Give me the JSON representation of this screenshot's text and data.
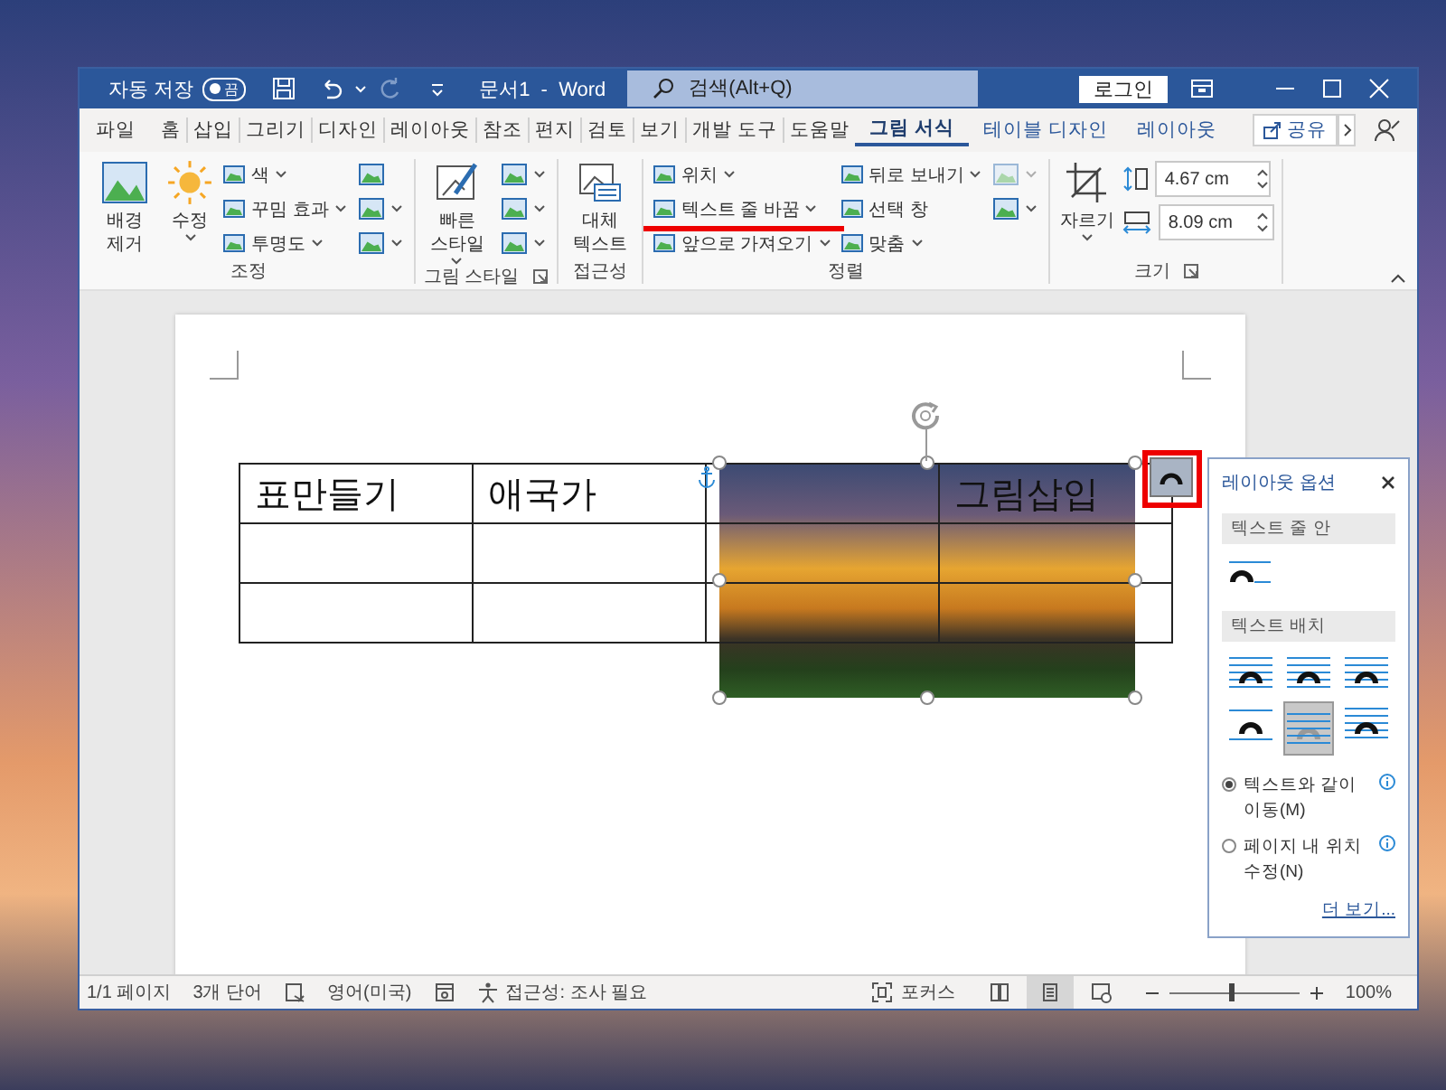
{
  "title_bar": {
    "autosave_label": "자동 저장",
    "autosave_toggle": {
      "label": "끔",
      "on": false
    },
    "document_title": "문서1  -  Word",
    "search": {
      "placeholder": "검색(Alt+Q)"
    },
    "login_button": "로그인"
  },
  "ribbon_tabs": [
    {
      "label": "파일",
      "kind": "normal",
      "selected": false
    },
    {
      "label": "홈",
      "kind": "normal",
      "selected": false
    },
    {
      "label": "삽입",
      "kind": "normal",
      "selected": false
    },
    {
      "label": "그리기",
      "kind": "normal",
      "selected": false
    },
    {
      "label": "디자인",
      "kind": "normal",
      "selected": false
    },
    {
      "label": "레이아웃",
      "kind": "normal",
      "selected": false
    },
    {
      "label": "참조",
      "kind": "normal",
      "selected": false
    },
    {
      "label": "편지",
      "kind": "normal",
      "selected": false
    },
    {
      "label": "검토",
      "kind": "normal",
      "selected": false
    },
    {
      "label": "보기",
      "kind": "normal",
      "selected": false
    },
    {
      "label": "개발 도구",
      "kind": "normal",
      "selected": false
    },
    {
      "label": "도움말",
      "kind": "normal",
      "selected": false
    },
    {
      "label": "그림 서식",
      "kind": "contextual",
      "selected": true
    },
    {
      "label": "테이블 디자인",
      "kind": "contextual",
      "selected": false
    },
    {
      "label": "레이아웃",
      "kind": "contextual",
      "selected": false
    }
  ],
  "share_button": {
    "label": "공유"
  },
  "ribbon_groups": [
    {
      "label": "조정",
      "launcher": false,
      "columns": [
        [
          {
            "kind": "large",
            "label": "배경 제거",
            "dropdown": false
          }
        ],
        [
          {
            "kind": "large",
            "label": "수정",
            "dropdown": true
          }
        ],
        [
          {
            "kind": "small",
            "label": "색",
            "dropdown": true,
            "highlighted": false
          },
          {
            "kind": "small",
            "label": "꾸밈 효과",
            "dropdown": true,
            "highlighted": false
          },
          {
            "kind": "small",
            "label": "투명도",
            "dropdown": true,
            "highlighted": false
          }
        ],
        [
          {
            "kind": "icon",
            "dropdown": false,
            "disabled": false
          },
          {
            "kind": "icon",
            "dropdown": true,
            "disabled": false
          },
          {
            "kind": "icon",
            "dropdown": true,
            "disabled": false
          }
        ]
      ]
    },
    {
      "label": "그림 스타일",
      "launcher": true,
      "columns": [
        [
          {
            "kind": "large",
            "label": "빠른 스타일",
            "dropdown": true
          }
        ],
        [
          {
            "kind": "icon",
            "dropdown": true,
            "disabled": false
          },
          {
            "kind": "icon",
            "dropdown": true,
            "disabled": false
          },
          {
            "kind": "icon",
            "dropdown": true,
            "disabled": false
          }
        ]
      ]
    },
    {
      "label": "접근성",
      "launcher": false,
      "columns": [
        [
          {
            "kind": "large",
            "label": "대체 텍스트",
            "dropdown": false
          }
        ]
      ]
    },
    {
      "label": "정렬",
      "launcher": false,
      "columns": [
        [
          {
            "kind": "small",
            "label": "위치",
            "dropdown": true,
            "highlighted": false
          },
          {
            "kind": "small",
            "label": "텍스트 줄 바꿈",
            "dropdown": true,
            "highlighted": true
          },
          {
            "kind": "small",
            "label": "앞으로 가져오기",
            "dropdown": true,
            "highlighted": false
          }
        ],
        [
          {
            "kind": "small",
            "label": "뒤로 보내기",
            "dropdown": true,
            "highlighted": false
          },
          {
            "kind": "small",
            "label": "선택 창",
            "dropdown": false,
            "highlighted": false
          },
          {
            "kind": "small",
            "label": "맞춤",
            "dropdown": true,
            "highlighted": false
          }
        ],
        [
          {
            "kind": "icon",
            "dropdown": true,
            "disabled": true
          },
          {
            "kind": "icon",
            "dropdown": true,
            "disabled": false
          }
        ]
      ]
    },
    {
      "label": "크기",
      "launcher": true,
      "columns": [
        [
          {
            "kind": "large",
            "label": "자르기",
            "dropdown": true
          }
        ],
        [
          {
            "kind": "spin",
            "value": "4.67 cm"
          },
          {
            "kind": "spin",
            "value": "8.09 cm"
          }
        ]
      ]
    }
  ],
  "document": {
    "table": {
      "rows": [
        [
          "표만들기",
          "애국가",
          null,
          "그림삽입"
        ],
        [
          null,
          null,
          null,
          null
        ],
        [
          null,
          null,
          null,
          null
        ]
      ]
    },
    "picture": {
      "selected": true
    },
    "layout_options_button": {
      "highlighted": true
    }
  },
  "layout_panel": {
    "title": "레이아웃 옵션",
    "sections": [
      {
        "heading": "텍스트 줄 안",
        "options": [
          {
            "selected": false
          }
        ]
      },
      {
        "heading": "텍스트 배치",
        "options": [
          {
            "selected": false
          },
          {
            "selected": false
          },
          {
            "selected": false
          },
          {
            "selected": false
          },
          {
            "selected": true
          },
          {
            "selected": false
          }
        ]
      }
    ],
    "radios": [
      {
        "label": "텍스트와 같이 이동(M)",
        "selected": true
      },
      {
        "label": "페이지 내 위치 수정(N)",
        "selected": false
      }
    ],
    "more_link": "더 보기..."
  },
  "status_bar": {
    "page": "1/1 페이지",
    "words": "3개 단어",
    "language": "영어(미국)",
    "accessibility": "접근성: 조사 필요",
    "focus": "포커스",
    "views": [
      {
        "selected": false
      },
      {
        "selected": true
      },
      {
        "selected": false
      }
    ],
    "zoom": {
      "level": 0.47,
      "reading": "100%"
    }
  }
}
